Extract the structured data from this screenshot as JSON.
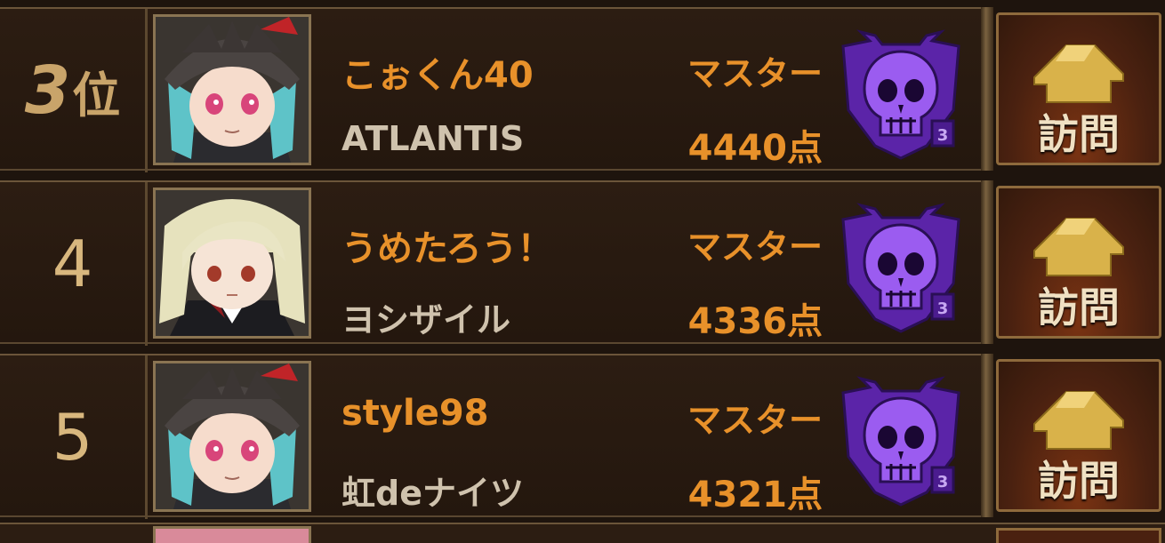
{
  "ranking": {
    "rows": [
      {
        "rank": "3",
        "rank_suffix": "位",
        "name": "こぉくん40",
        "guild": "ATLANTIS",
        "tier": "マスター",
        "score": "4440点",
        "visit_label": "訪問",
        "avatar": "knight-helmet-avatar-icon",
        "badge": "master-skull-badge-icon"
      },
      {
        "rank": "4",
        "rank_suffix": "",
        "name": "うめたろう！",
        "guild": "ヨシザイル",
        "tier": "マスター",
        "score": "4336点",
        "visit_label": "訪問",
        "avatar": "blonde-hair-avatar-icon",
        "badge": "master-skull-badge-icon"
      },
      {
        "rank": "5",
        "rank_suffix": "",
        "name": "style98",
        "guild": "虹deナイツ",
        "tier": "マスター",
        "score": "4321点",
        "visit_label": "訪問",
        "avatar": "knight-helmet-avatar-icon",
        "badge": "master-skull-badge-icon"
      }
    ]
  },
  "colors": {
    "name": "#e8912a",
    "guild": "#cfc2ad",
    "rank": "#d8b77e",
    "badge": "#7b3fd1"
  }
}
